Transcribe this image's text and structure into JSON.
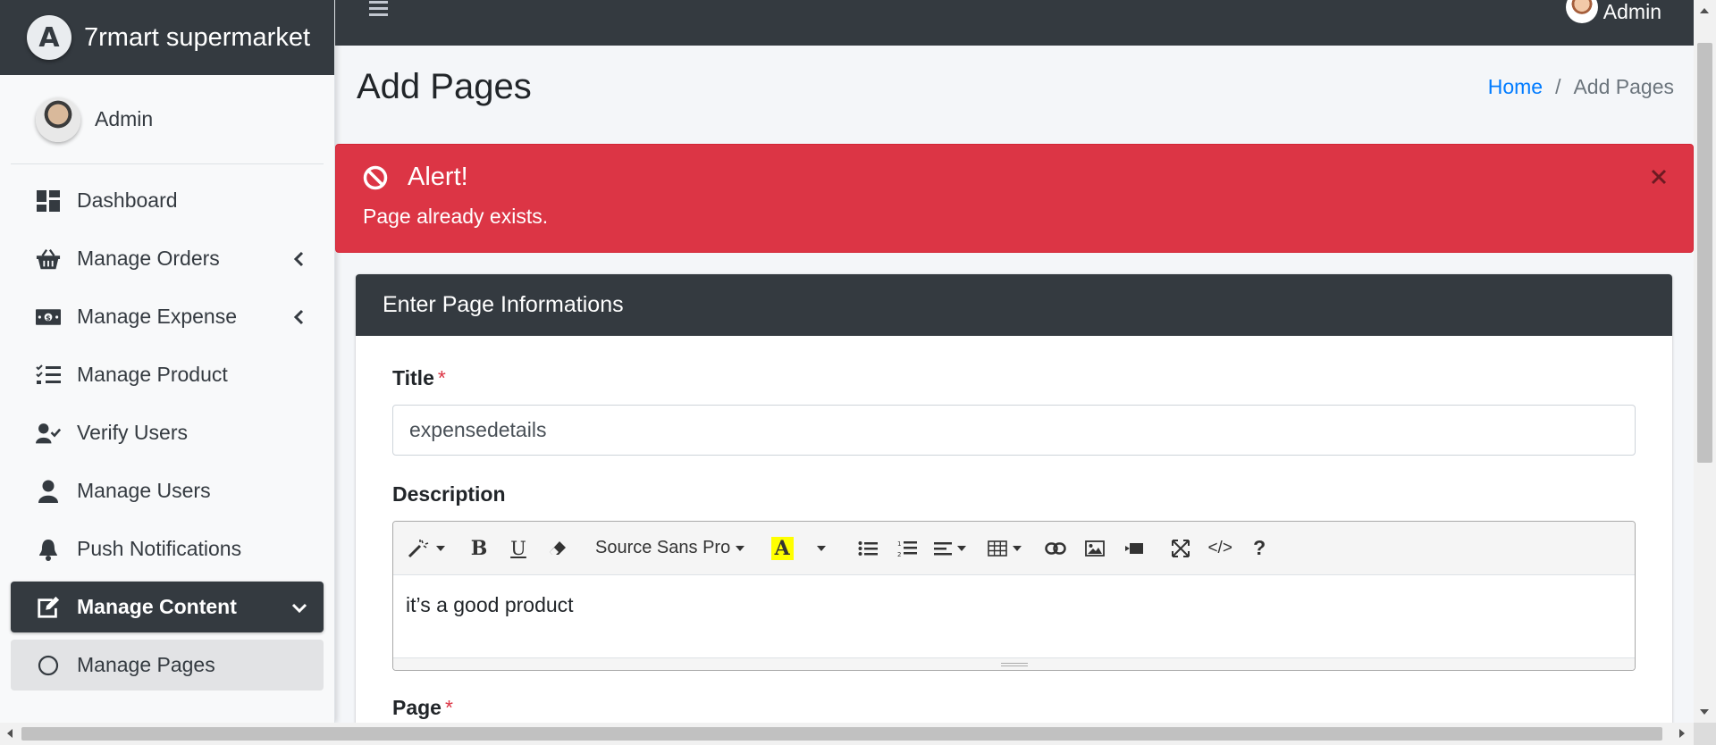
{
  "brand": {
    "logo_letter": "A",
    "name": "7rmart supermarket"
  },
  "user": {
    "name": "Admin"
  },
  "topbar": {
    "user_name": "Admin"
  },
  "sidebar": {
    "items": [
      {
        "label": "Dashboard",
        "icon": "dashboard-icon"
      },
      {
        "label": "Manage Orders",
        "icon": "basket-icon",
        "chevron": "left"
      },
      {
        "label": "Manage Expense",
        "icon": "money-icon",
        "chevron": "left"
      },
      {
        "label": "Manage Product",
        "icon": "list-check-icon"
      },
      {
        "label": "Verify Users",
        "icon": "user-check-icon"
      },
      {
        "label": "Manage Users",
        "icon": "user-icon"
      },
      {
        "label": "Push Notifications",
        "icon": "bell-icon"
      },
      {
        "label": "Manage Content",
        "icon": "edit-icon",
        "chevron": "down",
        "active": true
      },
      {
        "label": "Manage Pages",
        "icon": "circle-icon",
        "sub": true
      }
    ]
  },
  "page": {
    "title": "Add Pages",
    "breadcrumb": {
      "home": "Home",
      "sep": "/",
      "current": "Add Pages"
    }
  },
  "alert": {
    "heading": "Alert!",
    "message": "Page already exists.",
    "close": "×",
    "color": "#dc3545"
  },
  "form": {
    "header": "Enter Page Informations",
    "title_label": "Title",
    "required_mark": "*",
    "title_value": "expensedetails",
    "description_label": "Description",
    "font_name": "Source Sans Pro",
    "description_value": "it’s a good product",
    "page_label": "Page"
  },
  "toolbar": {
    "buttons": [
      "style-icon",
      "bold-icon",
      "underline-icon",
      "eraser-icon",
      "font-select",
      "highlight-icon",
      "bullet-list-icon",
      "numbered-list-icon",
      "align-icon",
      "table-icon",
      "link-icon",
      "image-icon",
      "video-icon",
      "fullscreen-icon",
      "code-view-icon",
      "help-icon"
    ],
    "bold": "B",
    "underline": "U",
    "highlight": "A",
    "code": "</>",
    "help": "?"
  }
}
